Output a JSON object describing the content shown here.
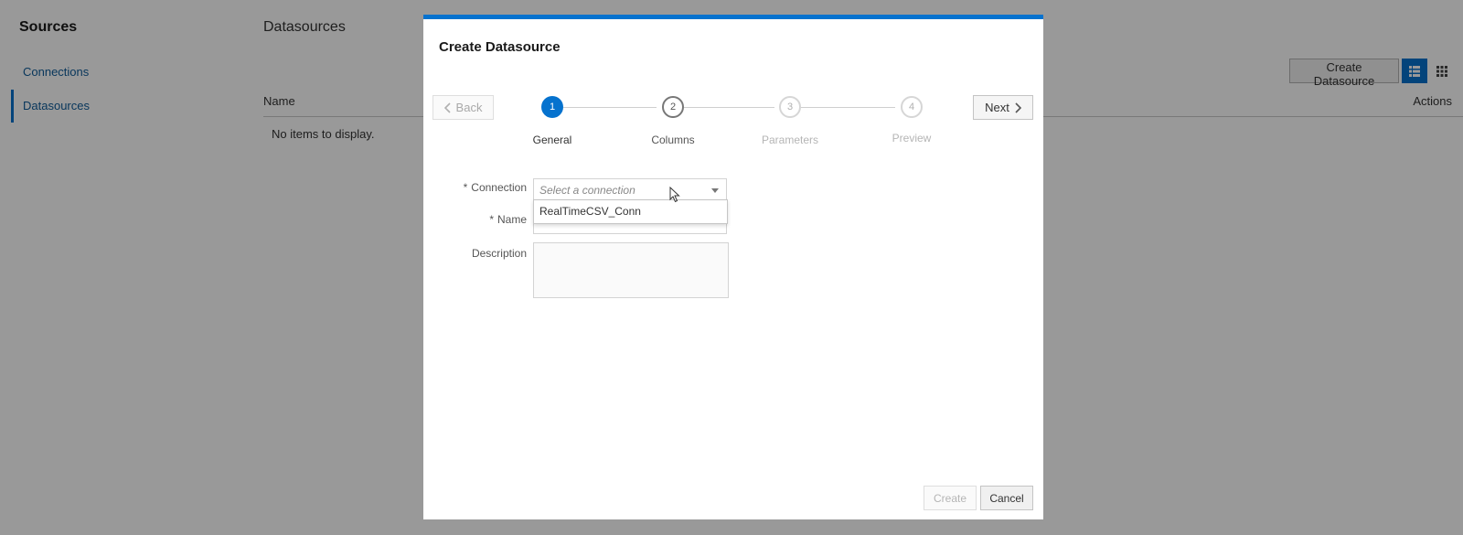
{
  "background": {
    "sidebar": {
      "title": "Sources",
      "items": [
        {
          "label": "Connections",
          "active": false
        },
        {
          "label": "Datasources",
          "active": true
        }
      ]
    },
    "main": {
      "title": "Datasources",
      "create_button": "Create Datasource",
      "columns": {
        "name": "Name",
        "actions": "Actions"
      },
      "empty_message": "No items to display."
    }
  },
  "dialog": {
    "title": "Create Datasource",
    "back_label": "Back",
    "next_label": "Next",
    "steps": [
      {
        "number": "1",
        "label": "General",
        "state": "active"
      },
      {
        "number": "2",
        "label": "Columns",
        "state": "done"
      },
      {
        "number": "3",
        "label": "Parameters",
        "state": "future"
      },
      {
        "number": "4",
        "label": "Preview",
        "state": "future"
      }
    ],
    "form": {
      "required_marker": "*",
      "connection_label": "Connection",
      "connection_placeholder": "Select a connection",
      "connection_options": [
        "RealTimeCSV_Conn"
      ],
      "name_label": "Name",
      "name_value": "",
      "description_label": "Description",
      "description_value": ""
    },
    "create_label": "Create",
    "cancel_label": "Cancel"
  },
  "colors": {
    "accent": "#0572ce",
    "link": "#0f5c99",
    "overlay": "rgba(0,0,0,0.4)"
  }
}
